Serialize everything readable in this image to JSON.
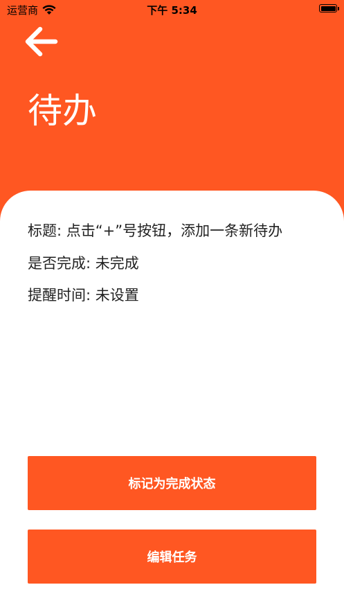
{
  "status_bar": {
    "carrier": "运营商",
    "time": "下午 5:34",
    "battery_level": 1.0
  },
  "header": {
    "back_icon": "arrow-left-icon",
    "title": "待办"
  },
  "details": {
    "title_line": "标题: 点击“+”号按钮，添加一条新待办",
    "completed_line": "是否完成: 未完成",
    "reminder_line": "提醒时间: 未设置"
  },
  "actions": {
    "mark_complete_label": "标记为完成状态",
    "edit_label": "编辑任务"
  },
  "colors": {
    "accent": "#FF5722",
    "text": "#222222",
    "background": "#FFFFFF"
  }
}
